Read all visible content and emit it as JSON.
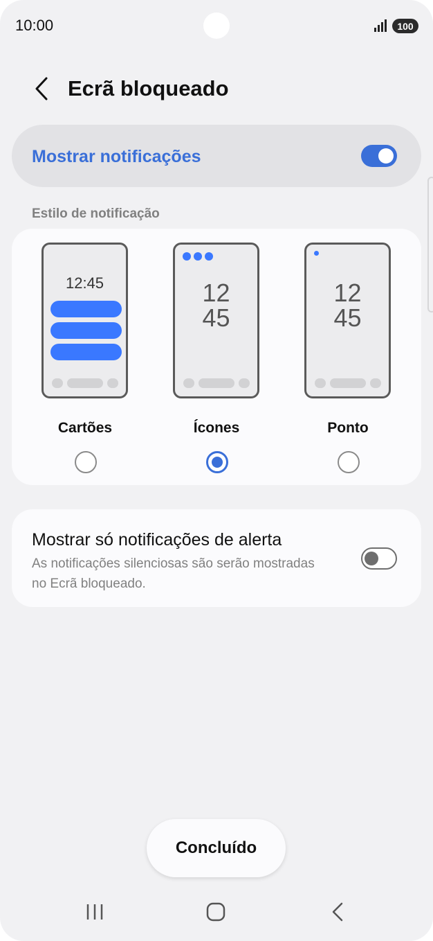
{
  "status_bar": {
    "time": "10:00",
    "battery": "100"
  },
  "header": {
    "title": "Ecrã bloqueado"
  },
  "master_toggle": {
    "label": "Mostrar notificações",
    "state": "on"
  },
  "notification_style": {
    "section_label": "Estilo de notificação",
    "options": [
      {
        "label": "Cartões",
        "clock": "12:45",
        "selected": false
      },
      {
        "label": "Ícones",
        "clock_hours": "12",
        "clock_minutes": "45",
        "selected": true
      },
      {
        "label": "Ponto",
        "clock_hours": "12",
        "clock_minutes": "45",
        "selected": false
      }
    ]
  },
  "alert_only": {
    "title": "Mostrar só notificações de alerta",
    "description": "As notificações silenciosas são serão mostradas no Ecrã bloqueado.",
    "state": "off"
  },
  "done_button": {
    "label": "Concluído"
  },
  "colors": {
    "accent": "#3a6fd8",
    "card_bar": "#3a78ff",
    "background": "#f1f1f3"
  },
  "icons": [
    "back-chevron-icon",
    "signal-icon",
    "battery-icon",
    "recents-icon",
    "home-icon",
    "nav-back-icon"
  ]
}
